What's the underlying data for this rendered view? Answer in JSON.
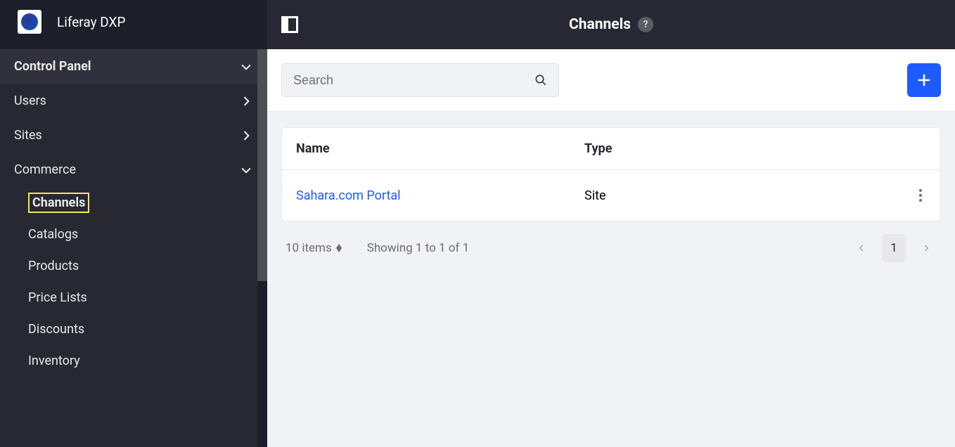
{
  "brand": {
    "title": "Liferay DXP"
  },
  "sidebar": {
    "control_panel": "Control Panel",
    "users": "Users",
    "sites": "Sites",
    "commerce": "Commerce",
    "sub": {
      "channels": "Channels",
      "catalogs": "Catalogs",
      "products": "Products",
      "price_lists": "Price Lists",
      "discounts": "Discounts",
      "inventory": "Inventory"
    }
  },
  "header": {
    "title": "Channels",
    "help": "?"
  },
  "search": {
    "placeholder": "Search"
  },
  "table": {
    "head": {
      "name": "Name",
      "type": "Type"
    },
    "rows": [
      {
        "name": "Sahara.com Portal",
        "type": "Site"
      }
    ]
  },
  "pagination": {
    "items_label": "10 items",
    "showing": "Showing 1 to 1 of 1",
    "current_page": "1"
  }
}
